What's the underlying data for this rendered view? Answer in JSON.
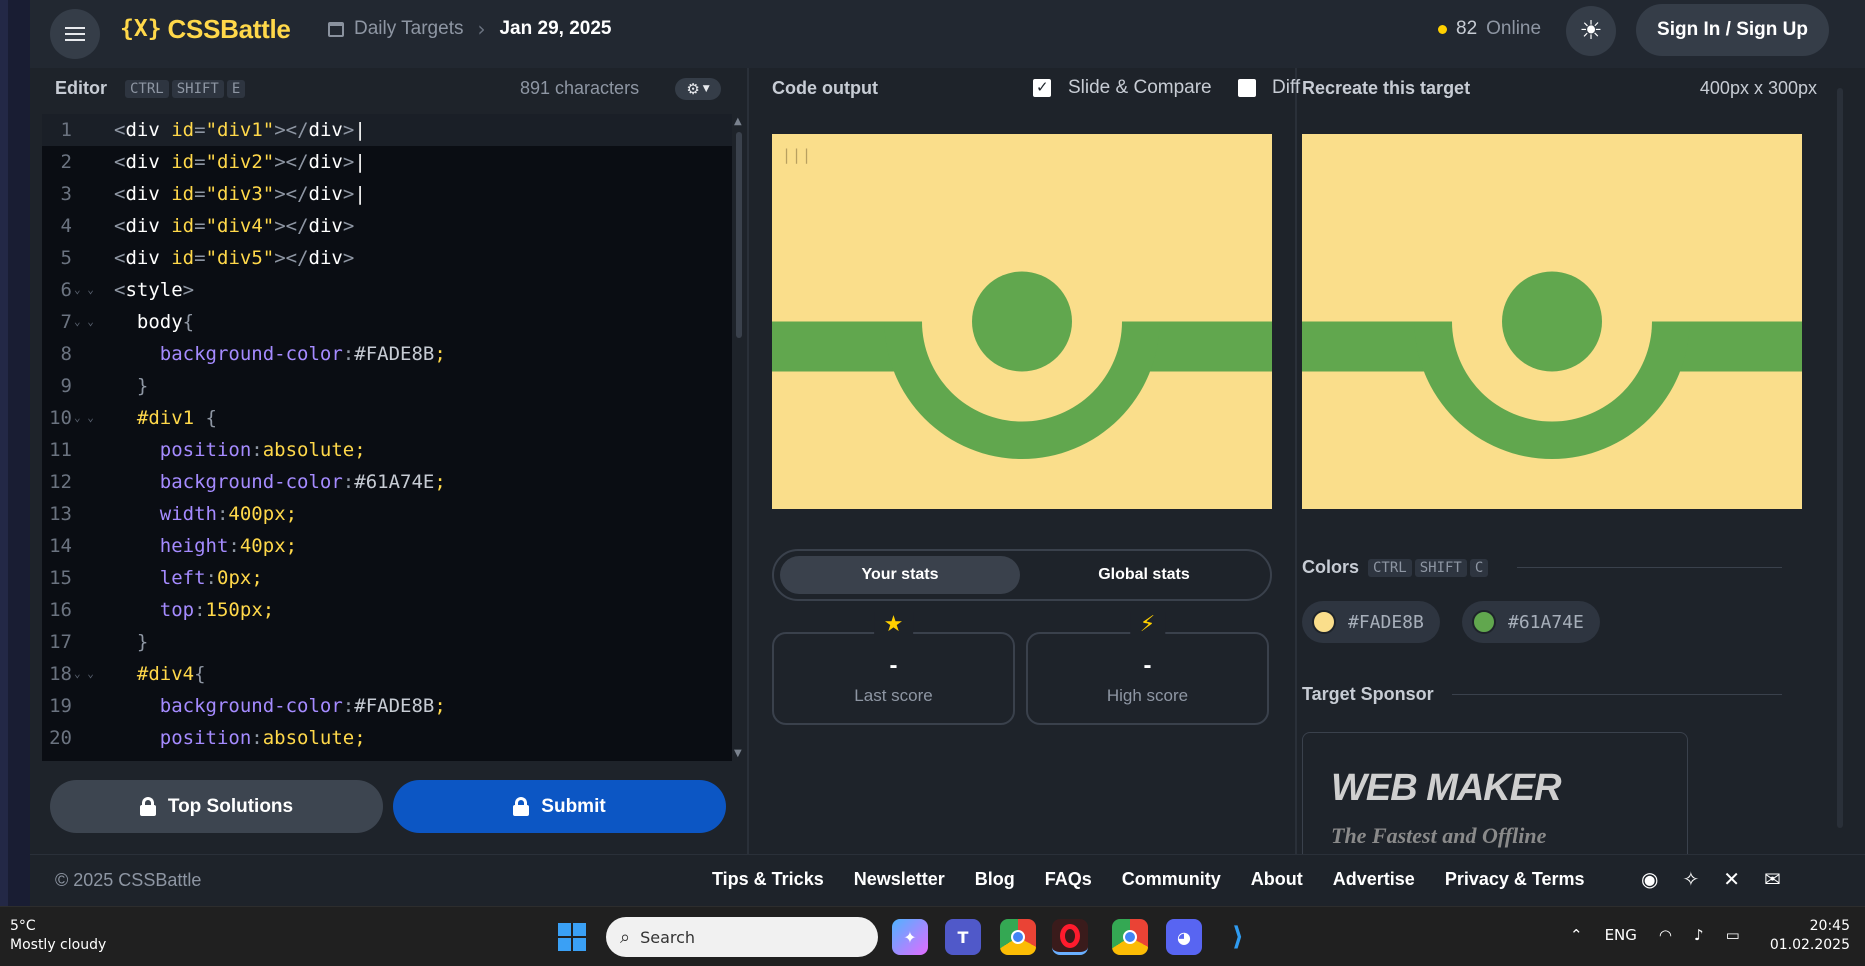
{
  "header": {
    "logo_mark": "{X}",
    "logo_text": "CSSBattle",
    "breadcrumb_section": "Daily Targets",
    "breadcrumb_date": "Jan 29, 2025",
    "online_count": "82",
    "online_label": "Online",
    "signin_label": "Sign In / Sign Up"
  },
  "editor": {
    "title": "Editor",
    "shortcut": [
      "CTRL",
      "SHIFT",
      "E"
    ],
    "char_count": "891 characters",
    "lines": [
      {
        "n": "1",
        "text": "<div id=\"div1\"></div>|",
        "active": true
      },
      {
        "n": "2",
        "text": "<div id=\"div2\"></div>|"
      },
      {
        "n": "3",
        "text": "<div id=\"div3\"></div>|"
      },
      {
        "n": "4",
        "text": "<div id=\"div4\"></div>"
      },
      {
        "n": "5",
        "text": "<div id=\"div5\"></div>"
      },
      {
        "n": "6",
        "text": "<style>",
        "fold": true
      },
      {
        "n": "7",
        "text": "  body{",
        "fold": true
      },
      {
        "n": "8",
        "text": "    background-color:#FADE8B;"
      },
      {
        "n": "9",
        "text": "  }"
      },
      {
        "n": "10",
        "text": "  #div1 {",
        "fold": true
      },
      {
        "n": "11",
        "text": "    position:absolute;"
      },
      {
        "n": "12",
        "text": "    background-color:#61A74E;"
      },
      {
        "n": "13",
        "text": "    width:400px;"
      },
      {
        "n": "14",
        "text": "    height:40px;"
      },
      {
        "n": "15",
        "text": "    left:0px;"
      },
      {
        "n": "16",
        "text": "    top:150px;"
      },
      {
        "n": "17",
        "text": "  }"
      },
      {
        "n": "18",
        "text": "  #div4{",
        "fold": true
      },
      {
        "n": "19",
        "text": "    background-color:#FADE8B;"
      },
      {
        "n": "20",
        "text": "    position:absolute;"
      }
    ],
    "top_solutions_label": "Top Solutions",
    "submit_label": "Submit"
  },
  "output": {
    "title": "Code output",
    "slide_compare_label": "Slide & Compare",
    "slide_compare_checked": true,
    "diff_label": "Diff",
    "diff_checked": false,
    "cursor_text": "|||",
    "tab_your_stats": "Your stats",
    "tab_global_stats": "Global stats",
    "last_score_value": "-",
    "last_score_label": "Last score",
    "high_score_value": "-",
    "high_score_label": "High score"
  },
  "target": {
    "title": "Recreate this target",
    "size": "400px x 300px",
    "colors_title": "Colors",
    "colors_shortcut": [
      "CTRL",
      "SHIFT",
      "C"
    ],
    "colors": [
      {
        "hex": "#FADE8B"
      },
      {
        "hex": "#61A74E"
      }
    ],
    "sponsor_title": "Target Sponsor",
    "sponsor_logo": "WEB MAKER",
    "sponsor_tagline": "The Fastest and Offline"
  },
  "footer": {
    "copyright": "© 2025 CSSBattle",
    "links": [
      "Tips & Tricks",
      "Newsletter",
      "Blog",
      "FAQs",
      "Community",
      "About",
      "Advertise",
      "Privacy & Terms"
    ],
    "social_icons": [
      "discord-icon",
      "bluesky-icon",
      "x-icon",
      "mail-icon"
    ]
  },
  "taskbar": {
    "temperature": "5°C",
    "weather": "Mostly cloudy",
    "search_placeholder": "Search",
    "language": "ENG",
    "time": "20:45",
    "date": "01.02.2025"
  },
  "theme": {
    "accent": "#ffd84a",
    "primary_button": "#0c56c4",
    "canvas_bg": "#FADE8B",
    "canvas_fg": "#61A74E"
  }
}
